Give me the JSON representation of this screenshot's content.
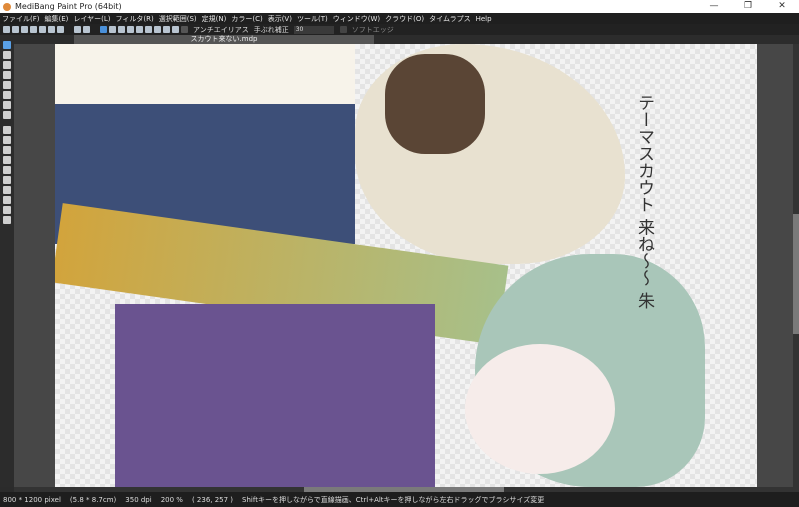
{
  "window": {
    "title": "MediBang Paint Pro (64bit)",
    "minimize": "—",
    "maximize": "❐",
    "close": "✕"
  },
  "menu": [
    "ファイル(F)",
    "編集(E)",
    "レイヤー(L)",
    "フィルタ(R)",
    "選択範囲(S)",
    "定規(N)",
    "カラー(C)",
    "表示(V)",
    "ツール(T)",
    "ウィンドウ(W)",
    "クラウド(O)",
    "タイムラプス",
    "Help"
  ],
  "toolbar": {
    "antialias_label": "アンチエイリアス",
    "stabilizer_label": "手ぶれ補正",
    "stabilizer_value": "30",
    "soft_edge_label": "ソフトエッジ"
  },
  "document": {
    "tab_title": "スカウト来ない.mdp",
    "handwriting": [
      "テーマスカウト",
      "来ね〜〜 朱"
    ]
  },
  "status": {
    "size": "800 * 1200 pixel",
    "physical": "(5.8 * 8.7cm)",
    "dpi": "350 dpi",
    "zoom": "200 %",
    "coords": "( 236, 257 )",
    "hint": "Shiftキーを押しながらで直線描画、Ctrl+Altキーを押しながら左右ドラッグでブラシサイズ変更"
  }
}
